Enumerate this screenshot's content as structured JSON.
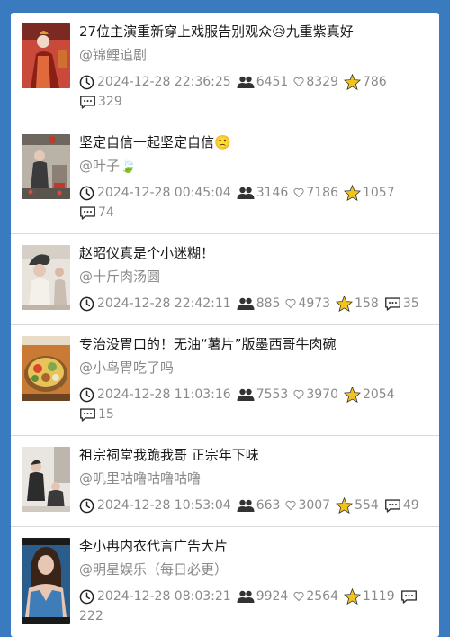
{
  "items": [
    {
      "title": "27位主演重新穿上戏服告别观众😥九重紫真好",
      "author": "@锦鲤追剧",
      "time": "2024-12-28 22:36:25",
      "viewers": "6451",
      "likes": "8329",
      "stars": "786",
      "comments": "329",
      "thumb": {
        "bg": "#c94a3a",
        "accent": "#f0d9c8",
        "accent2": "#8a1f16"
      }
    },
    {
      "title": "坚定自信一起坚定自信🙁",
      "author": "@叶子🍃",
      "time": "2024-12-28 00:45:04",
      "viewers": "3146",
      "likes": "7186",
      "stars": "1057",
      "comments": "74",
      "thumb": {
        "bg": "#b9b2a6",
        "accent": "#3b3b3b",
        "accent2": "#c0392b"
      }
    },
    {
      "title": "赵昭仪真是个小迷糊！",
      "author": "@十斤肉汤圆",
      "time": "2024-12-28 22:42:11",
      "viewers": "885",
      "likes": "4973",
      "stars": "158",
      "comments": "35",
      "thumb": {
        "bg": "#e8e3dc",
        "accent": "#3a3a3a",
        "accent2": "#d9b8a8"
      }
    },
    {
      "title": "专治没胃口的！无油“薯片”版墨西哥牛肉碗",
      "author": "@小鸟胃吃了吗",
      "time": "2024-12-28 11:03:16",
      "viewers": "7553",
      "likes": "3970",
      "stars": "2054",
      "comments": "15",
      "thumb": {
        "bg": "#d98b3a",
        "accent": "#e7c35a",
        "accent2": "#7fa84a"
      }
    },
    {
      "title": "祖宗祠堂我跪我哥 正宗年下味",
      "author": "@叽里咕噜咕噜咕噜",
      "time": "2024-12-28 10:53:04",
      "viewers": "663",
      "likes": "3007",
      "stars": "554",
      "comments": "49",
      "thumb": {
        "bg": "#e9e6e2",
        "accent": "#2c2c2c",
        "accent2": "#bdb6ad"
      }
    },
    {
      "title": "李小冉内衣代言广告大片",
      "author": "@明星娱乐（每日必更）",
      "time": "2024-12-28 08:03:21",
      "viewers": "9924",
      "likes": "2564",
      "stars": "1119",
      "comments": "222",
      "thumb": {
        "bg": "#2b5d8c",
        "accent": "#e8c6b4",
        "accent2": "#1a1a1a"
      }
    }
  ],
  "colors": {
    "background": "#3a7bbf",
    "card": "#ffffff",
    "meta_text": "#8a8a8a",
    "star": "#f2c31c"
  }
}
